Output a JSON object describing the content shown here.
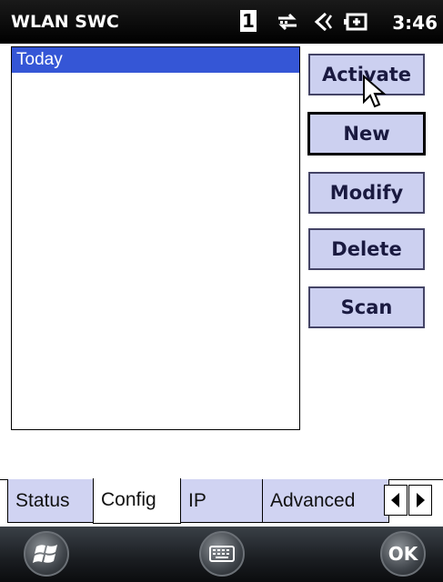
{
  "titlebar": {
    "app_title": "WLAN SWC",
    "signal_indicator": "1",
    "time": "3:46",
    "icons": [
      "data-connection-icon",
      "volume-icon",
      "battery-icon"
    ]
  },
  "profiles": {
    "items": [
      {
        "label": "Today",
        "selected": true
      }
    ]
  },
  "buttons": {
    "activate": "Activate",
    "new": "New",
    "modify": "Modify",
    "delete": "Delete",
    "scan": "Scan"
  },
  "tabs": {
    "items": [
      {
        "label": "Status",
        "active": false
      },
      {
        "label": "Config",
        "active": true
      },
      {
        "label": "IP",
        "active": false
      },
      {
        "label": "Advanced",
        "active": false
      }
    ],
    "scroll_left_icon": "arrow-left-icon",
    "scroll_right_icon": "arrow-right-icon"
  },
  "softkeys": {
    "start_icon": "windows-start-icon",
    "keyboard_icon": "keyboard-icon",
    "ok_label": "OK"
  },
  "colors": {
    "selection": "#3556d6",
    "button_face": "#ccd0f0",
    "tab_face": "#d0d3f2",
    "titlebar": "#000000"
  }
}
